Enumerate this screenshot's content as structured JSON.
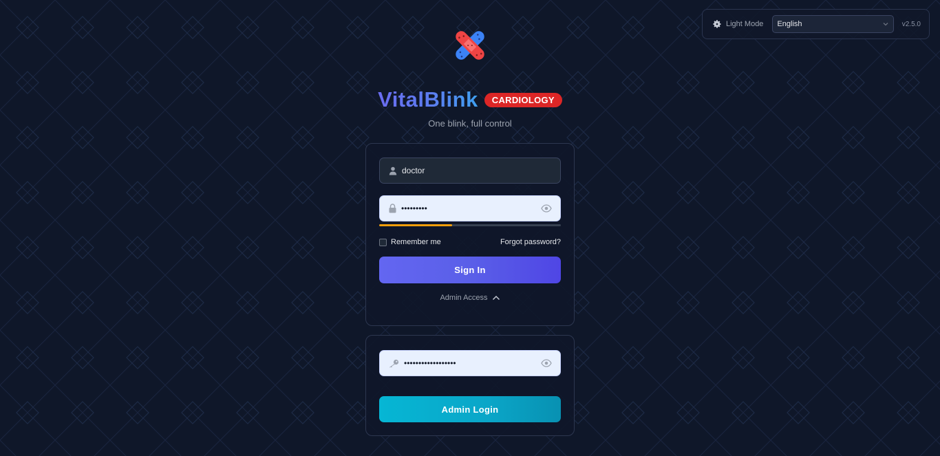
{
  "toolbar": {
    "theme_label": "Light Mode",
    "language_selected": "English",
    "version": "v2.5.0"
  },
  "brand": {
    "name": "VitalBlink",
    "badge": "CARDIOLOGY",
    "tagline": "One blink, full control"
  },
  "login": {
    "username_value": "doctor",
    "password_masked": "•••••••••",
    "password_strength": 0.4,
    "remember_label": "Remember me",
    "forgot_label": "Forgot password?",
    "signin_label": "Sign In",
    "admin_toggle_label": "Admin Access"
  },
  "admin": {
    "key_masked": "••••••••••••••••••",
    "login_label": "Admin Login"
  },
  "colors": {
    "background": "#0f1729",
    "primary": "#6366f1",
    "admin_button": "#06b6d4",
    "badge": "#dc2626",
    "strength": "#f59e0b"
  },
  "icons": {
    "theme": "gear-icon",
    "language": "chevron-down-icon",
    "logo": "crossed-bandage-icon",
    "user": "user-icon",
    "password": "lock-icon",
    "reveal": "eye-icon",
    "admin_toggle": "chevron-up-icon",
    "admin_key": "key-icon"
  }
}
